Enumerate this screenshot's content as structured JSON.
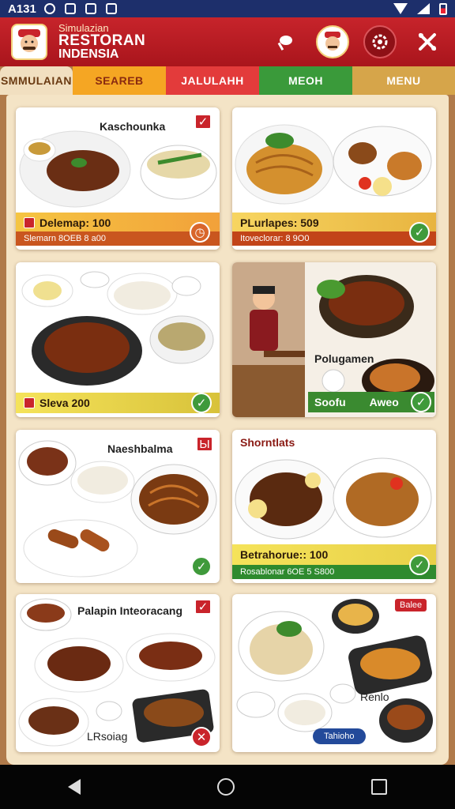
{
  "status": {
    "time": "A131"
  },
  "header": {
    "subtitle": "Simulazian",
    "title_line1": "RESTORAN",
    "title_line2": "INDENSIA",
    "icons": [
      "leaf-icon",
      "chef-avatar",
      "gear-icon",
      "shuffle-icon"
    ]
  },
  "tabs": [
    {
      "label": "SMMULAIAN",
      "color": "#f1dfc0"
    },
    {
      "label": "SEAREB",
      "color": "#f5a623"
    },
    {
      "label": "JALULAHH",
      "color": "#e33b3b"
    },
    {
      "label": "MEOH",
      "color": "#3a9a3a"
    },
    {
      "label": "MENU",
      "color": "#d6a54a"
    }
  ],
  "cards": [
    {
      "name": "Kaschounka",
      "price": "Delemap: 100",
      "sub": "Slemarn 8OEB 8 a00"
    },
    {
      "name": "",
      "price": "PLurlapes: 509",
      "sub": "Itoveclorar: 8 9O0"
    },
    {
      "name": "",
      "price": "Sleva 200",
      "sub": ""
    },
    {
      "name": "Polugamen",
      "price": "Soofu",
      "sub": "Aweo"
    },
    {
      "name": "Naeshbalma",
      "price": "",
      "sub": ""
    },
    {
      "name": "Shorntlats",
      "price": "Betrahorue:: 100",
      "sub": "Rosablonar 6OE 5 S800"
    },
    {
      "name": "Palapin Inteoracang",
      "price": "LRsoiag",
      "sub": ""
    },
    {
      "name": "Renlo",
      "price": "",
      "sub": "",
      "tag": "Balee",
      "badge": "Tahioho"
    }
  ],
  "colors": {
    "header": "#c7242b",
    "content_bg": "#f4e4c6",
    "check_green": "#3f9a3b",
    "accent_red": "#c9242b"
  }
}
